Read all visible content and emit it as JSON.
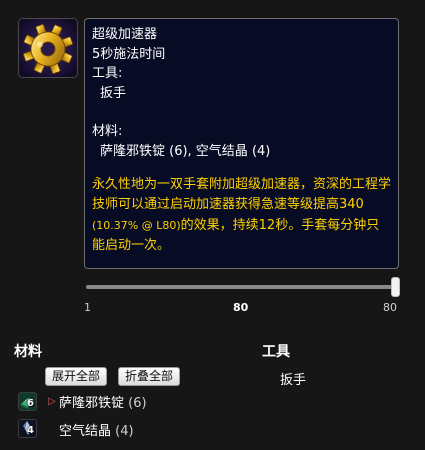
{
  "tooltip": {
    "title": "超级加速器",
    "cast_time": "5秒施法时间",
    "tools_label": "工具:",
    "tool": "扳手",
    "materials_label": "材料:",
    "materials": "萨隆邪铁锭 (6), 空气结晶 (4)",
    "desc_before": "永久性地为一双手套附加超级加速器，资深的工程学技师可以通过启动加速器获得急速等级提高340 ",
    "desc_small": "(10.37% @ L80)",
    "desc_after": "的效果，持续12秒。手套每分钟只能启动一次。"
  },
  "slider": {
    "min": "1",
    "current": "80",
    "max": "80"
  },
  "materials_section": {
    "heading": "材料",
    "expand_all": "展开全部",
    "collapse_all": "折叠全部",
    "items": [
      {
        "name": "萨隆邪铁锭",
        "count": "6",
        "qty": "(6)",
        "icon": "saronite-bar-icon"
      },
      {
        "name": "空气结晶",
        "count": "4",
        "qty": "(4)",
        "icon": "crystallized-air-icon"
      }
    ]
  },
  "tools_section": {
    "heading": "工具",
    "items": [
      "扳手"
    ]
  },
  "colors": {
    "tooltip_bg": "#070b24",
    "description": "#ffd100",
    "page_bg": "#161616"
  }
}
